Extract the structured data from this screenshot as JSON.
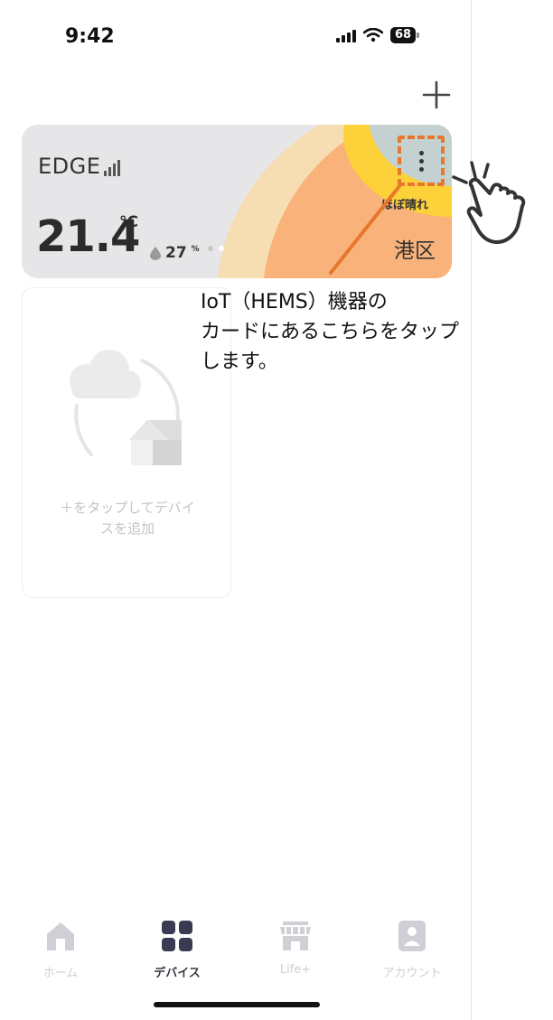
{
  "status_bar": {
    "time": "9:42",
    "battery": "68"
  },
  "header": {
    "add_icon": "plus-icon"
  },
  "weather_card": {
    "brand": "EDGE",
    "temperature": "21.4",
    "temperature_unit": "°C",
    "humidity_value": "27",
    "humidity_unit": "%",
    "weather": "ほぼ晴れ",
    "location": "港区",
    "menu_icon": "more-vertical-icon",
    "colors": {
      "card_bg": "#e6e6e8",
      "orange": "#f9b27a",
      "peach": "#f6ddb2",
      "yellow": "#fdd13a",
      "sky": "#c3d1d0",
      "highlight": "#e8772e"
    }
  },
  "annotation": {
    "text_line1": "IoT（HEMS）機器の",
    "text_line2": "カードにあるこちらをタップ",
    "text_line3": "します。"
  },
  "add_device_card": {
    "text_line1": "＋をタップしてデバイ",
    "text_line2": "スを追加"
  },
  "bottom_nav": {
    "items": [
      {
        "label": "ホーム",
        "icon": "home-icon",
        "active": false
      },
      {
        "label": "デバイス",
        "icon": "devices-grid-icon",
        "active": true
      },
      {
        "label": "Life+",
        "icon": "store-icon",
        "active": false
      },
      {
        "label": "アカウント",
        "icon": "account-icon",
        "active": false
      }
    ]
  }
}
